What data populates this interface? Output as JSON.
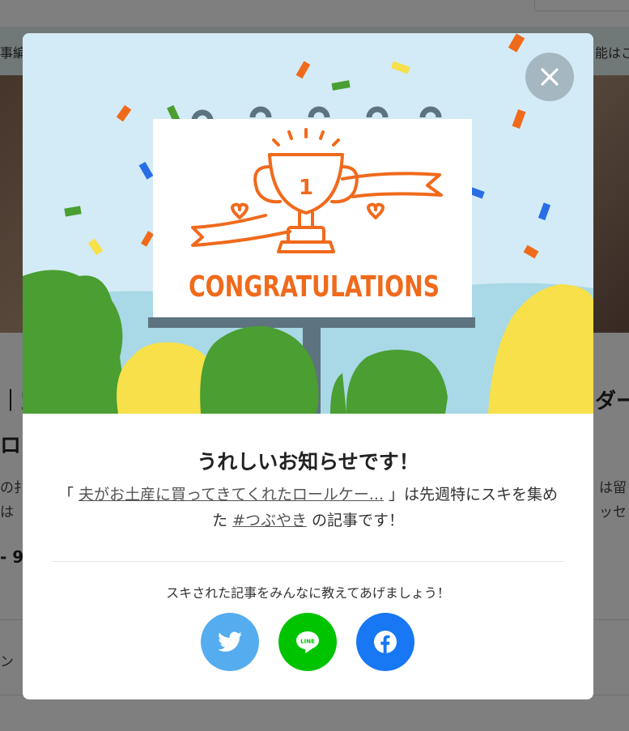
{
  "background": {
    "banner_left": "事編",
    "banner_right": "能はこ",
    "title_line1": "｜宝",
    "title_line2": "ロン",
    "title_right": "ダー",
    "para_left1": "の扌",
    "para_left2": "は",
    "para_right1": "は留",
    "para_right2": "ッセ",
    "count": "- 9",
    "fragment": "ン"
  },
  "modal": {
    "banner_text": "CONGRATULATIONS",
    "trophy_number": "1",
    "title": "うれしいお知らせです！",
    "message": {
      "open_quote": "「 ",
      "article_link": "夫がお土産に買ってきてくれたロールケー...",
      "mid": " 」は先週特にスキを集めた ",
      "hashtag": "#つぶやき",
      "end": " の記事です！"
    },
    "share_prompt": "スキされた記事をみんなに教えてあげましょう！",
    "share_buttons": [
      {
        "name": "twitter",
        "icon": "twitter-bird-icon",
        "color": "#55acee"
      },
      {
        "name": "line",
        "icon": "line-icon",
        "label": "LINE",
        "color": "#00c300"
      },
      {
        "name": "facebook",
        "icon": "facebook-f-icon",
        "color": "#1877f2"
      }
    ],
    "colors": {
      "accent_orange": "#f06a1c",
      "sky": "#d3ebf6",
      "tree_green": "#4a9e32",
      "tree_yellow": "#f7e04a"
    }
  }
}
